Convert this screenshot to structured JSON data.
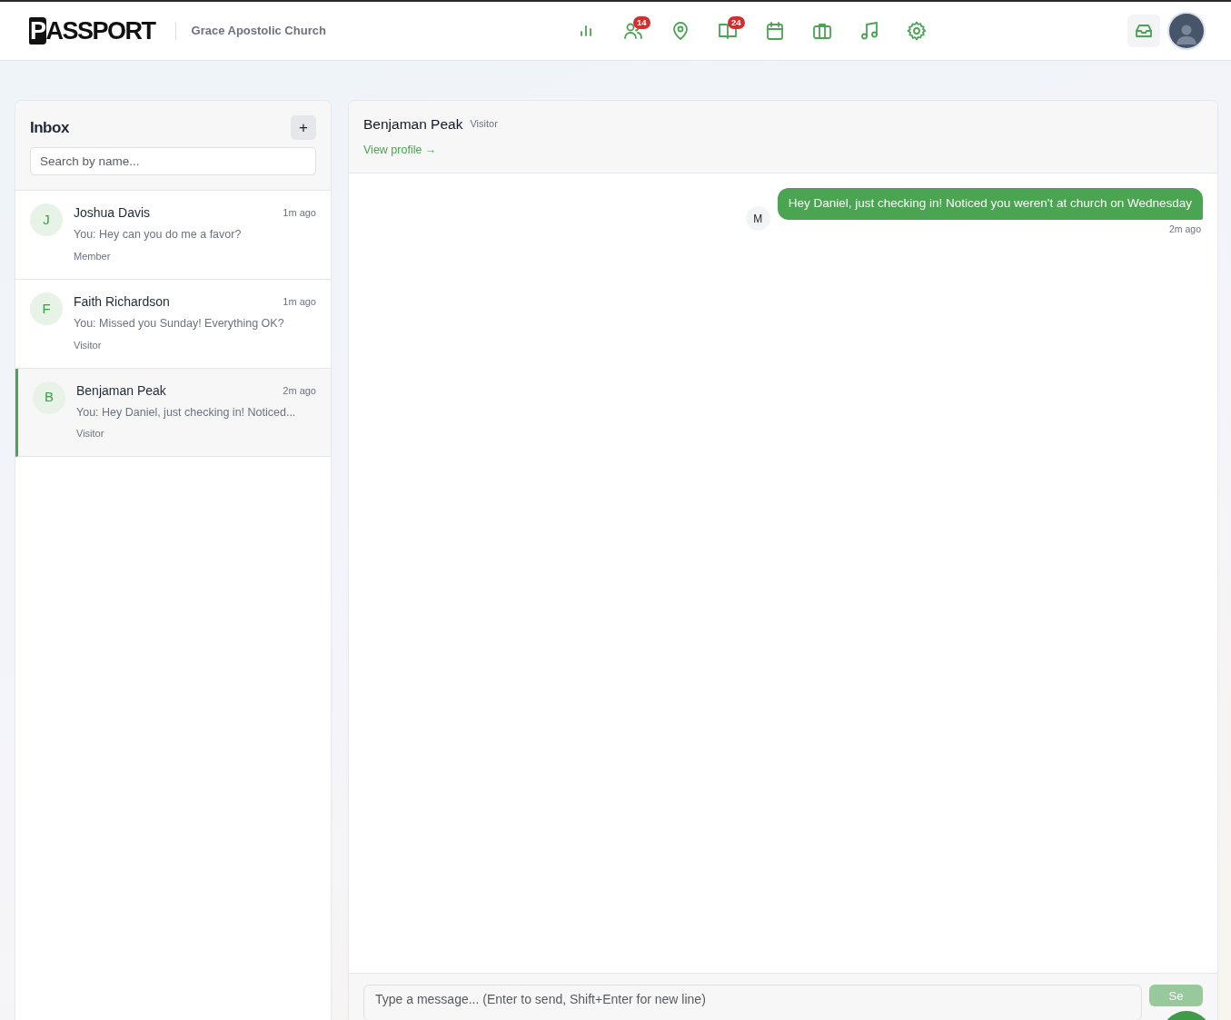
{
  "brand": {
    "logo": "PASSPORT",
    "organization": "Grace Apostolic Church"
  },
  "nav_icons": [
    {
      "kind": "chart"
    },
    {
      "kind": "people",
      "badge": "14"
    },
    {
      "kind": "pin"
    },
    {
      "kind": "book",
      "badge": "24"
    },
    {
      "kind": "calendar"
    },
    {
      "kind": "briefcase"
    },
    {
      "kind": "music"
    },
    {
      "kind": "gear"
    }
  ],
  "inbox": {
    "title": "Inbox",
    "add_label": "+",
    "search": {
      "placeholder": "Search by name..."
    },
    "conversations": [
      {
        "initial": "J",
        "name": "Joshua Davis",
        "time": "1m ago",
        "preview": "You: Hey can you do me a favor?",
        "role": "Member",
        "selected": false
      },
      {
        "initial": "F",
        "name": "Faith Richardson",
        "time": "1m ago",
        "preview": "You: Missed you Sunday! Everything OK?",
        "role": "Visitor",
        "selected": false
      },
      {
        "initial": "B",
        "name": "Benjaman Peak",
        "time": "2m ago",
        "preview": "You: Hey Daniel, just checking in! Noticed...",
        "role": "Visitor",
        "selected": true
      }
    ]
  },
  "chat": {
    "name": "Benjaman Peak",
    "role": "Visitor",
    "profile_link": "View profile →",
    "messages": [
      {
        "text": "Hey Daniel, just checking in! Noticed you weren't at church on Wednesday",
        "time": "2m ago",
        "sender_initial": "M",
        "outgoing": true
      }
    ],
    "composer": {
      "placeholder": "Type a message... (Enter to send, Shift+Enter for new line)",
      "send_label": "Se",
      "send_disabled": true
    }
  }
}
